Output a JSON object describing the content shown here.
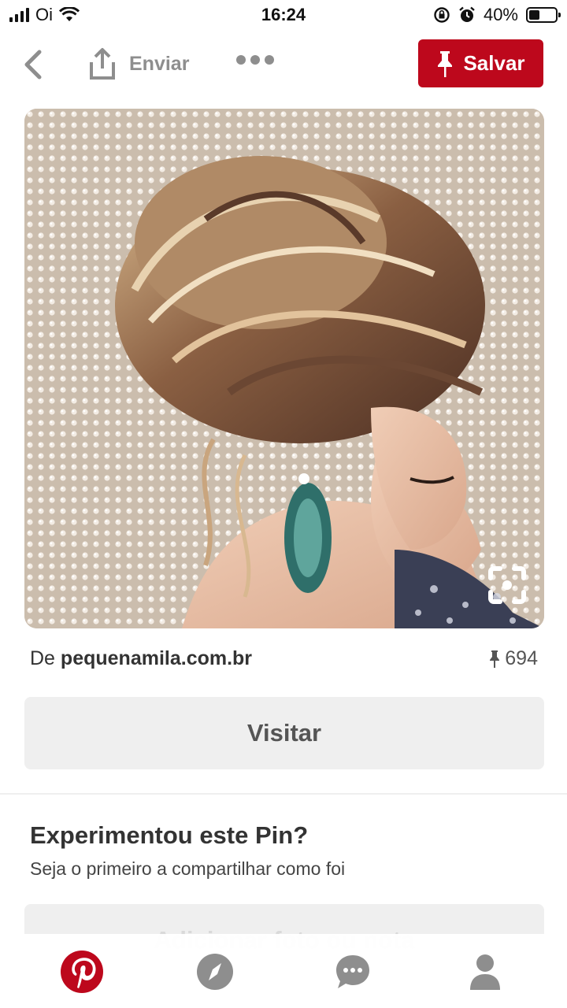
{
  "status_bar": {
    "carrier": "Oi",
    "time": "16:24",
    "battery": "40%",
    "battery_level": 0.4
  },
  "toolbar": {
    "back_icon": "chevron-left-icon",
    "share_label": "Enviar",
    "more_icon": "more-dots-icon",
    "save_label": "Salvar",
    "save_color": "#bd081c"
  },
  "pin": {
    "image_description_icon": "visual-search-icon"
  },
  "source": {
    "prefix": "De",
    "domain": "pequenamila.com.br",
    "save_count": "694"
  },
  "visit_label": "Visitar",
  "tried": {
    "title": "Experimentou este Pin?",
    "subtitle": "Seja o primeiro a compartilhar como foi",
    "add_photo_label": "Adicionar foto ou nota"
  },
  "tabbar": {
    "items": [
      {
        "name": "home",
        "icon": "pinterest-logo-icon",
        "active": true
      },
      {
        "name": "explore",
        "icon": "compass-icon",
        "active": false
      },
      {
        "name": "messages",
        "icon": "chat-bubble-icon",
        "active": false
      },
      {
        "name": "profile",
        "icon": "person-icon",
        "active": false
      }
    ]
  }
}
